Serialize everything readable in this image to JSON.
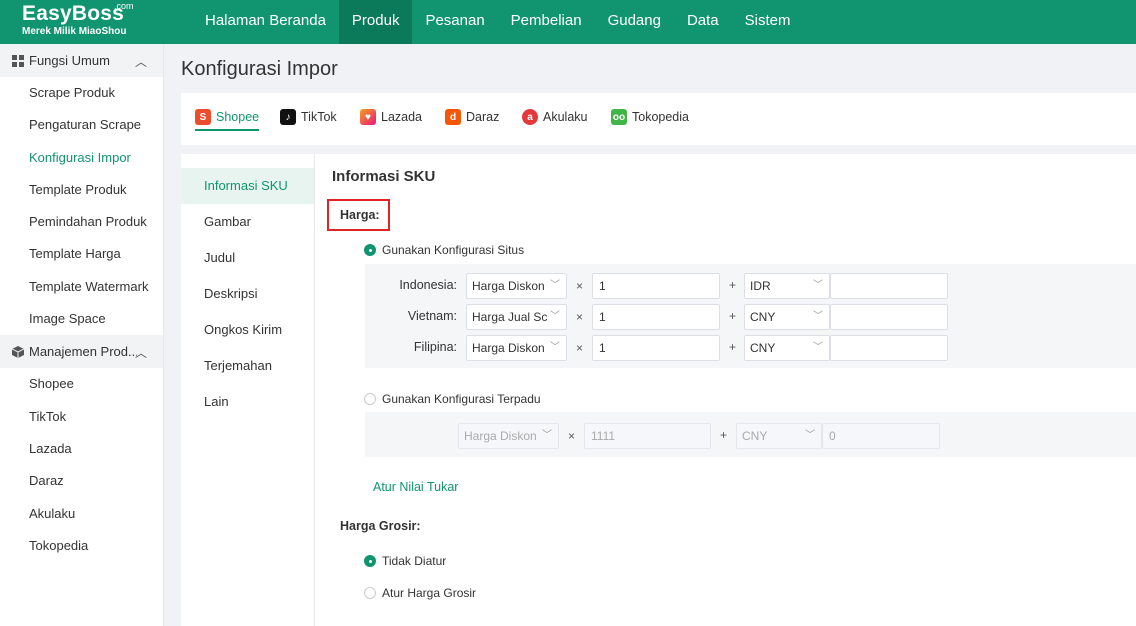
{
  "app": {
    "logo": "EasyBoss",
    "logo_suffix": ".com",
    "logo_sub": "Merek Milik MiaoShou"
  },
  "nav": [
    "Halaman Beranda",
    "Produk",
    "Pesanan",
    "Pembelian",
    "Gudang",
    "Data",
    "Sistem"
  ],
  "nav_active": "Produk",
  "sidebar": {
    "groups": [
      {
        "label": "Fungsi Umum",
        "items": [
          "Scrape Produk",
          "Pengaturan Scrape",
          "Konfigurasi Impor",
          "Template Produk",
          "Pemindahan Produk",
          "Template Harga",
          "Template Watermark",
          "Image Space"
        ]
      },
      {
        "label": "Manajemen Prod...",
        "items": [
          "Shopee",
          "TikTok",
          "Lazada",
          "Daraz",
          "Akulaku",
          "Tokopedia"
        ]
      }
    ],
    "active": "Konfigurasi Impor"
  },
  "page_title": "Konfigurasi Impor",
  "platforms": [
    "Shopee",
    "TikTok",
    "Lazada",
    "Daraz",
    "Akulaku",
    "Tokopedia"
  ],
  "platform_active": "Shopee",
  "vtabs": [
    "Informasi SKU",
    "Gambar",
    "Judul",
    "Deskripsi",
    "Ongkos Kirim",
    "Terjemahan",
    "Lain"
  ],
  "vtab_active": "Informasi SKU",
  "section_title": "Informasi SKU",
  "harga_label": "Harga:",
  "radio_site": "Gunakan Konfigurasi Situs",
  "radio_unified": "Gunakan Konfigurasi Terpadu",
  "rows": [
    {
      "label": "Indonesia:",
      "price_type": "Harga Diskon",
      "multiplier": "1",
      "currency": "IDR",
      "extra": ""
    },
    {
      "label": "Vietnam:",
      "price_type": "Harga Jual Sc",
      "multiplier": "1",
      "currency": "CNY",
      "extra": ""
    },
    {
      "label": "Filipina:",
      "price_type": "Harga Diskon",
      "multiplier": "1",
      "currency": "CNY",
      "extra": ""
    }
  ],
  "unified": {
    "price_type": "Harga Diskon",
    "multiplier": "1111",
    "currency": "CNY",
    "extra": "0"
  },
  "operators": {
    "times": "×",
    "plus": "+"
  },
  "exchange_link": "Atur Nilai Tukar",
  "grosir_label": "Harga Grosir:",
  "radio_no_set": "Tidak Diatur",
  "radio_set_grosir": "Atur Harga Grosir",
  "colors": {
    "brand": "#119470",
    "highlight": "#e02424"
  }
}
